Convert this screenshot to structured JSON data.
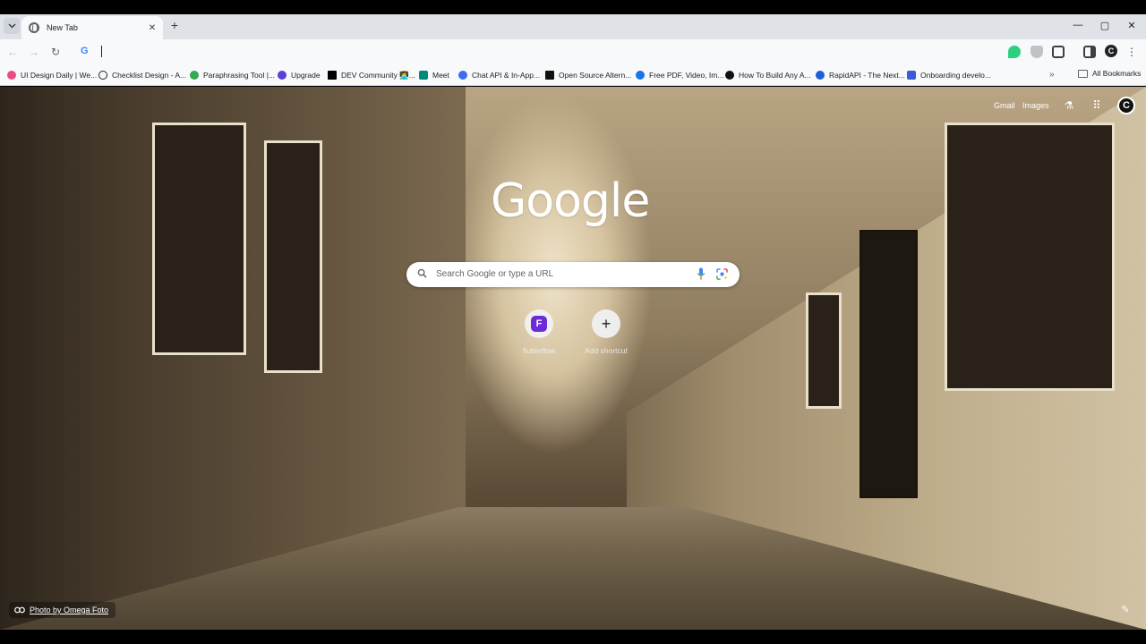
{
  "browser": {
    "tab": {
      "title": "New Tab",
      "close": "✕"
    },
    "new_tab_symbol": "+",
    "window_controls": {
      "minimize": "—",
      "restore": "▢",
      "close": "✕"
    },
    "nav": {
      "back": "←",
      "forward": "→",
      "reload": "↻",
      "search_icon_letter": "G"
    },
    "profile_letter": "C"
  },
  "bookmarks": {
    "items": [
      {
        "label": "UI Design Daily | We...",
        "color": "#e84d8a"
      },
      {
        "label": "Checklist Design - A...",
        "color": "#202124"
      },
      {
        "label": "Paraphrasing Tool |...",
        "color": "#34a853"
      },
      {
        "label": "Upgrade",
        "color": "#5b3fd6"
      },
      {
        "label": "DEV Community 👩‍💻...",
        "color": "#000000"
      },
      {
        "label": "Meet",
        "color": "#00897b"
      },
      {
        "label": "Chat API & In-App...",
        "color": "#3c6df0"
      },
      {
        "label": "Open Source Altern...",
        "color": "#111111"
      },
      {
        "label": "Free PDF, Video, Im...",
        "color": "#1a73e8"
      },
      {
        "label": "How To Build Any A...",
        "color": "#111111"
      },
      {
        "label": "RapidAPI - The Next...",
        "color": "#1c60d6"
      },
      {
        "label": "Onboarding develo...",
        "color": "#3c5bd6"
      }
    ],
    "more": "»",
    "all_bookmarks": "All Bookmarks"
  },
  "ntp": {
    "links": {
      "gmail": "Gmail",
      "images": "Images"
    },
    "avatar_letter": "C",
    "logo": "Google",
    "search": {
      "placeholder": "Search Google or type a URL"
    },
    "shortcuts": [
      {
        "label": "flutterflow",
        "icon_color": "#6c2bd9",
        "icon_glyph": "F"
      },
      {
        "label": "Add shortcut",
        "icon_glyph": "+"
      }
    ],
    "attribution": "Photo by Omega Foto",
    "customize_glyph": "✎"
  }
}
